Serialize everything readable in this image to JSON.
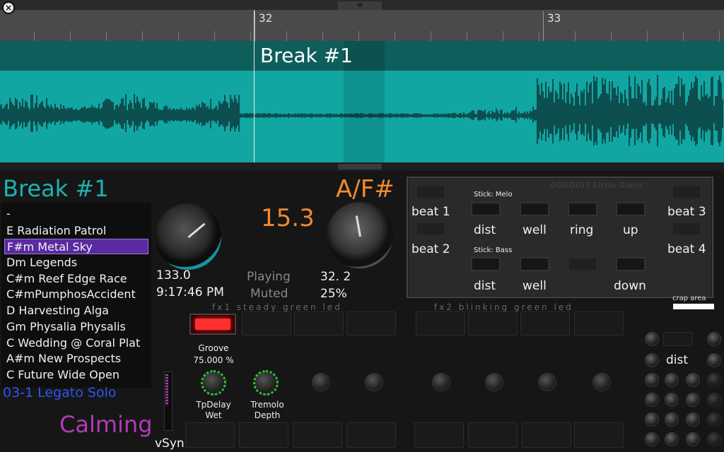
{
  "timeline": {
    "bar_32": "32",
    "bar_33": "33",
    "cue_label": "Break #1",
    "close_label": "×"
  },
  "left_panel": {
    "cue_title": "Break #1",
    "songs": [
      {
        "label": "-"
      },
      {
        "label": "E Radiation Patrol"
      },
      {
        "label": "F#m Metal Sky",
        "selected": true
      },
      {
        "label": "Dm Legends"
      },
      {
        "label": "C#m Reef Edge Race"
      },
      {
        "label": "C#mPumphosAccident"
      },
      {
        "label": "D Harvesting Alga"
      },
      {
        "label": "Gm Physalia Physalis"
      },
      {
        "label": "C Wedding @ Coral Plat"
      },
      {
        "label": "A#m New Prospects"
      },
      {
        "label": "C Future Wide Open"
      }
    ],
    "preset": "03-1 Legato Solo",
    "mood": "Calming",
    "vsync_label": "vSyn"
  },
  "readouts": {
    "tempo": "133.0",
    "clock": "9:17:46 PM",
    "energy": "15.3",
    "key": "A/F#",
    "status_playing": "Playing",
    "status_muted": "Muted",
    "position": "32. 2",
    "percent": "25%"
  },
  "controller": {
    "title": "GORDIUS Little Giant",
    "beat1": "beat 1",
    "beat2": "beat 2",
    "beat3": "beat 3",
    "beat4": "beat 4",
    "stick_melo": "Stick: Melo",
    "stick_bass": "Stick: Bass",
    "melo_pads": [
      "dist",
      "well",
      "ring",
      "up"
    ],
    "bass_pads": [
      "dist",
      "well",
      "",
      "down"
    ],
    "crap_area": "crap area"
  },
  "fx": {
    "fx1_caption": "fx1  steady  green  led",
    "fx2_caption": "fx2  blinking  green  led",
    "groove_label": "Groove",
    "groove_value": "75.000 %",
    "knob1_label_a": "TpDelay",
    "knob1_label_b": "Wet",
    "knob2_label_a": "Tremolo",
    "knob2_label_b": "Depth",
    "right_label": "dist"
  },
  "colors": {
    "waveform": "#12a6a3",
    "title_band": "#0e5e5c",
    "cue_title": "#1eb2b0",
    "orange": "#f08a30",
    "preset_blue": "#2b55f2",
    "mood_purple": "#b03ab8",
    "led_red": "#ff3030",
    "knob_ring_green": "#2ad02a"
  }
}
